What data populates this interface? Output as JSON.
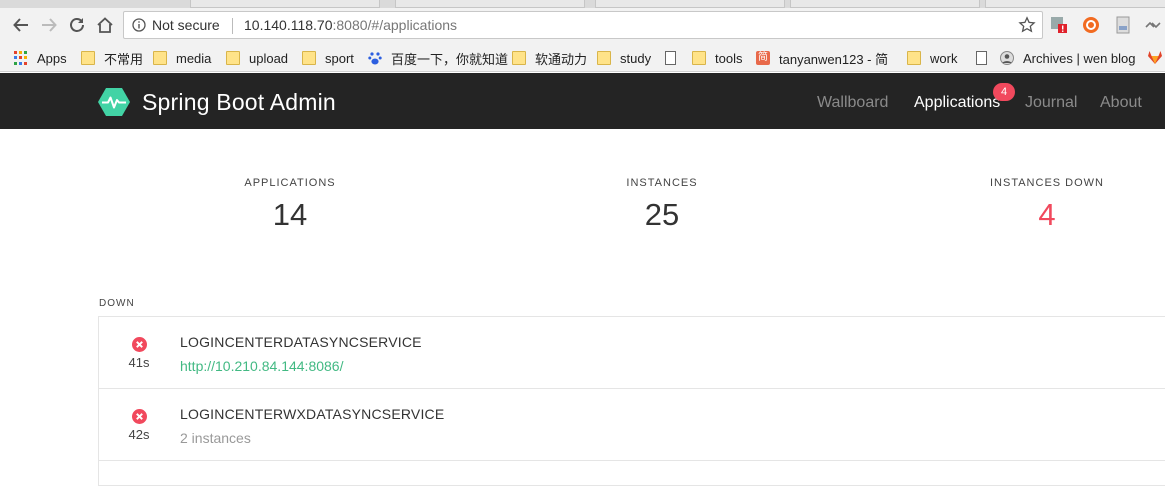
{
  "browser": {
    "address_security": "Not secure",
    "url_host": "10.140.118.70",
    "url_rest": ":8080/#/applications",
    "bookmarks": [
      {
        "label": "Apps",
        "icon": "apps-icon"
      },
      {
        "label": "不常用",
        "icon": "folder-icon"
      },
      {
        "label": "media",
        "icon": "folder-icon"
      },
      {
        "label": "upload",
        "icon": "folder-icon"
      },
      {
        "label": "sport",
        "icon": "folder-icon"
      },
      {
        "label": "百度一下，你就知道",
        "icon": "baidu-icon"
      },
      {
        "label": "软通动力",
        "icon": "folder-icon"
      },
      {
        "label": "study",
        "icon": "folder-icon"
      },
      {
        "label": "",
        "icon": "page-icon"
      },
      {
        "label": "tools",
        "icon": "folder-icon"
      },
      {
        "label": "tanyanwen123 - 简",
        "icon": "jianshu-icon"
      },
      {
        "label": "work",
        "icon": "folder-icon"
      },
      {
        "label": "",
        "icon": "page-icon"
      },
      {
        "label": "Archives | wen blog",
        "icon": "blog-avatar-icon"
      }
    ]
  },
  "header": {
    "title": "Spring Boot Admin",
    "nav": {
      "wallboard": "Wallboard",
      "applications": "Applications",
      "applications_badge": "4",
      "journal": "Journal",
      "about": "About"
    }
  },
  "stats": {
    "applications": {
      "label": "APPLICATIONS",
      "value": "14"
    },
    "instances": {
      "label": "INSTANCES",
      "value": "25"
    },
    "instances_down": {
      "label": "INSTANCES DOWN",
      "value": "4"
    }
  },
  "down_section": {
    "label": "DOWN",
    "items": [
      {
        "name": "LOGINCENTERDATASYNCSERVICE",
        "detail": "http://10.210.84.144:8086/",
        "time": "41s"
      },
      {
        "name": "LOGINCENTERWXDATASYNCSERVICE",
        "detail": "2 instances",
        "time": "42s"
      }
    ]
  },
  "colors": {
    "header_bg": "#242424",
    "brand_green": "#42d3a5",
    "down_red": "#f1495d",
    "link_green": "#42b983"
  }
}
